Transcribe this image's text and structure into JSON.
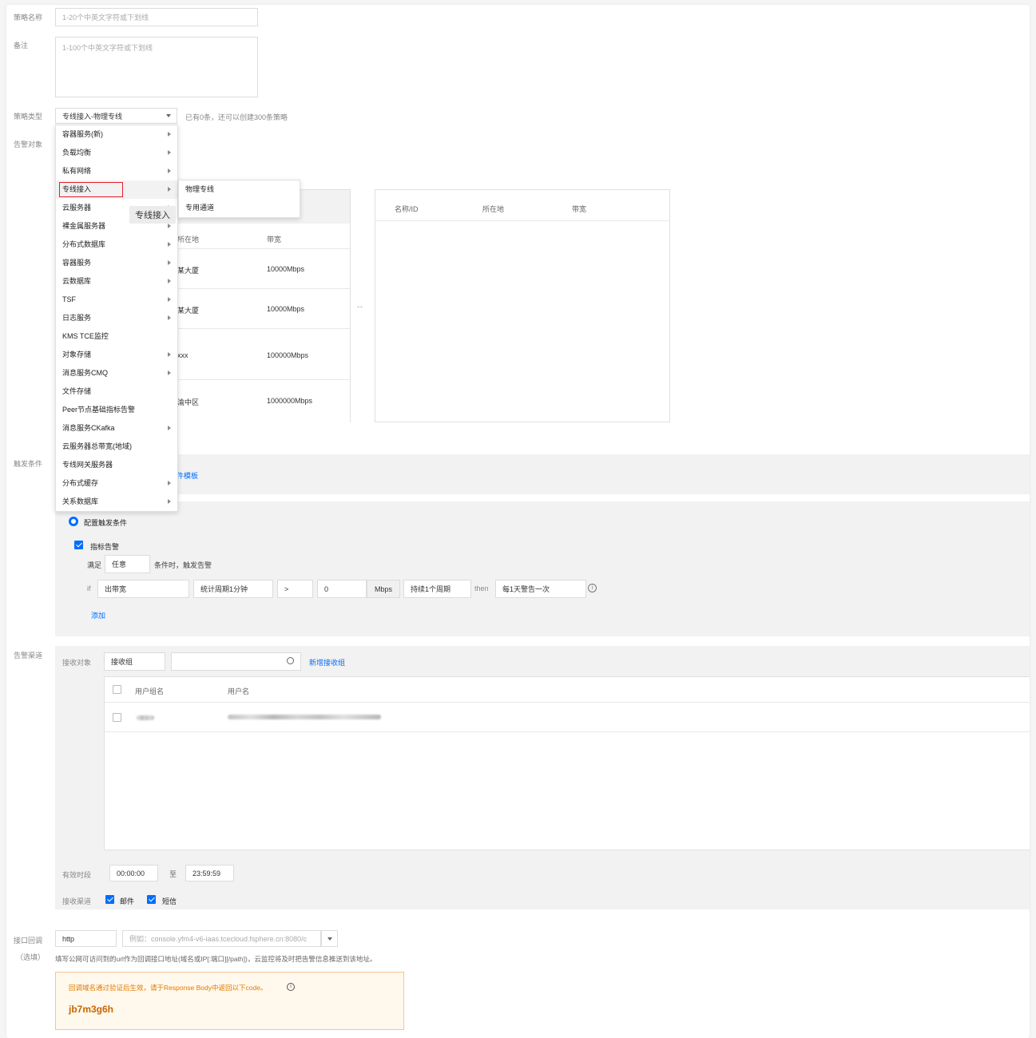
{
  "form": {
    "policy_name": {
      "label": "策略名称",
      "placeholder": "1-20个中英文字符或下划线"
    },
    "remark": {
      "label": "备注",
      "placeholder": "1-100个中英文字符或下划线"
    },
    "policy_type": {
      "label": "策略类型",
      "value": "专线接入-物理专线",
      "hint": "已有0条，还可以创建300条策略"
    },
    "alarm_object": {
      "label": "告警对象"
    },
    "trigger": {
      "label": "触发条件"
    },
    "channel": {
      "label": "告警渠道"
    },
    "callback": {
      "label": "接口回调",
      "label2": "（选填）"
    }
  },
  "type_menu": {
    "items": [
      {
        "label": "容器服务(新)",
        "sub": true
      },
      {
        "label": "负载均衡",
        "sub": true
      },
      {
        "label": "私有网络",
        "sub": true
      },
      {
        "label": "专线接入",
        "sub": true,
        "active": true
      },
      {
        "label": "云服务器",
        "sub": true
      },
      {
        "label": "裸金属服务器",
        "sub": true
      },
      {
        "label": "分布式数据库",
        "sub": true
      },
      {
        "label": "容器服务",
        "sub": true
      },
      {
        "label": "云数据库",
        "sub": true
      },
      {
        "label": "TSF",
        "sub": true
      },
      {
        "label": "日志服务",
        "sub": true
      },
      {
        "label": "KMS TCE监控",
        "sub": false
      },
      {
        "label": "对象存储",
        "sub": true
      },
      {
        "label": "消息服务CMQ",
        "sub": true
      },
      {
        "label": "文件存储",
        "sub": false
      },
      {
        "label": "Peer节点基础指标告警",
        "sub": false
      },
      {
        "label": "消息服务CKafka",
        "sub": true
      },
      {
        "label": "云服务器总带宽(地域)",
        "sub": false
      },
      {
        "label": "专线网关服务器",
        "sub": false
      },
      {
        "label": "分布式缓存",
        "sub": true
      },
      {
        "label": "关系数据库",
        "sub": true
      }
    ],
    "submenu": [
      "物理专线",
      "专用通道"
    ],
    "tooltip": "专线接入"
  },
  "left_table": {
    "headers": [
      "所在地",
      "带宽"
    ],
    "rows": [
      {
        "location": "某大厦",
        "bandwidth": "10000Mbps"
      },
      {
        "location": "某大厦",
        "bandwidth": "10000Mbps"
      },
      {
        "location": "xxx",
        "bandwidth": "100000Mbps"
      },
      {
        "location": "渝中区",
        "bandwidth": "1000000Mbps"
      }
    ]
  },
  "right_table": {
    "headers": [
      "名称/ID",
      "所在地",
      "带宽"
    ]
  },
  "trigger_panel": {
    "template_link_partial": "件模板",
    "radio_label": "配置触发条件",
    "metric_alarm": "指标告警",
    "satisfy": "满足",
    "any": "任意",
    "when_text": "条件时，触发告警",
    "if": "if",
    "metric": "出带宽",
    "period": "统计周期1分钟",
    "operator": ">",
    "threshold": "0",
    "unit": "Mbps",
    "duration": "持续1个周期",
    "then": "then",
    "frequency": "每1天警告一次",
    "add": "添加"
  },
  "channel_panel": {
    "receiver_label": "接收对象",
    "receiver_type": "接收组",
    "new_group": "新增接收组",
    "headers": [
      "用户组名",
      "用户名"
    ],
    "valid_period_label": "有效时段",
    "time_from": "00:00:00",
    "to": "至",
    "time_to": "23:59:59",
    "channel_label": "接收渠道",
    "email": "邮件",
    "sms": "短信"
  },
  "callback_panel": {
    "protocol": "http",
    "url_placeholder": "例如：console.yfm4-v6-iaas.tcecloud.fsphere.cn:8080/c",
    "hint": "填写公网可访问到的url作为回调接口地址(域名或IP[:端口][/path])，云监控将及时把告警信息推送到该地址。",
    "notice": "回调域名通过验证后生效，请于Response Body中返回以下code。",
    "code": "jb7m3g6h"
  }
}
